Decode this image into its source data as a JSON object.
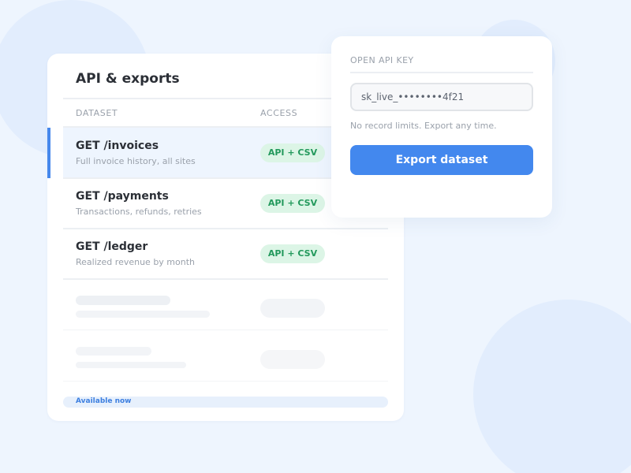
{
  "panel": {
    "title": "API & exports",
    "columns": {
      "dataset": "DATASET",
      "access": "ACCESS"
    },
    "rows": [
      {
        "endpoint": "GET /invoices",
        "description": "Full invoice history, all sites",
        "access": "API + CSV"
      },
      {
        "endpoint": "GET /payments",
        "description": "Transactions, refunds, retries",
        "access": "API + CSV"
      },
      {
        "endpoint": "GET /ledger",
        "description": "Realized revenue by month",
        "access": "API + CSV"
      }
    ],
    "footer": "Available now"
  },
  "api_card": {
    "label": "OPEN API KEY",
    "key_value": "sk_live_••••••••4f21",
    "note": "No record limits. Export any time.",
    "export_label": "Export dataset"
  },
  "colors": {
    "accent": "#4388ee",
    "pill_bg": "#dcf5e6",
    "pill_text": "#23995c",
    "selected_row": "#eef5fe"
  }
}
